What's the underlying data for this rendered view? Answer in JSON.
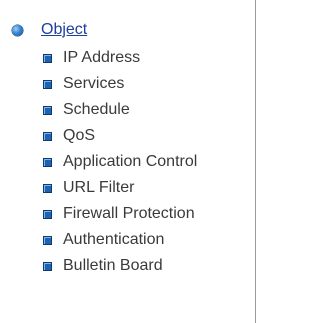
{
  "nav": {
    "root_label": "Object",
    "items": [
      {
        "label": "IP Address",
        "icon": "square-bullet-icon"
      },
      {
        "label": "Services",
        "icon": "square-bullet-icon"
      },
      {
        "label": "Schedule",
        "icon": "square-bullet-icon"
      },
      {
        "label": "QoS",
        "icon": "square-bullet-icon"
      },
      {
        "label": "Application Control",
        "icon": "square-bullet-icon"
      },
      {
        "label": "URL Filter",
        "icon": "square-bullet-icon"
      },
      {
        "label": "Firewall Protection",
        "icon": "square-bullet-icon"
      },
      {
        "label": "Authentication",
        "icon": "square-bullet-icon"
      },
      {
        "label": "Bulletin Board",
        "icon": "square-bullet-icon"
      }
    ]
  },
  "colors": {
    "root_link": "#1c3fa0",
    "item_text": "#3a3a3a",
    "bullet": "#1e62b0"
  }
}
